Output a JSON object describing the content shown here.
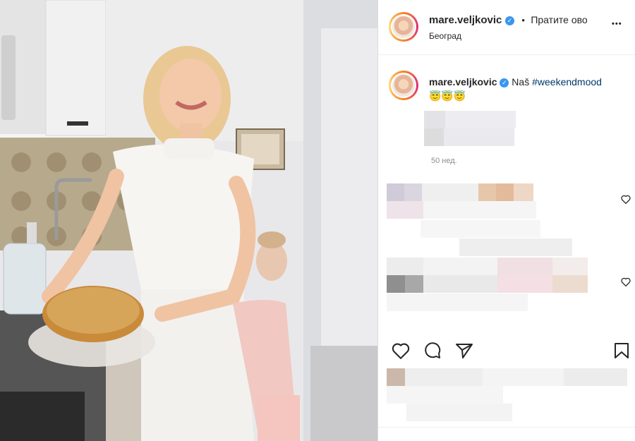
{
  "post": {
    "username": "mare.veljkovic",
    "follow_label": "Пратите ово",
    "dot_separator": "•",
    "location": "Београд",
    "more_label": "•••"
  },
  "caption": {
    "username": "mare.veljkovic",
    "text": "Naš",
    "hashtag": "#weekendmood",
    "emojis": "😇😇😇",
    "time_ago": "50 нед."
  },
  "icons": {
    "verified": "verified-badge-icon",
    "like": "heart-icon",
    "comment": "comment-bubble-icon",
    "share": "paper-plane-icon",
    "save": "bookmark-icon",
    "comment_like": "small-heart-icon"
  },
  "colors": {
    "verified_blue": "#3897f0",
    "hashtag_blue": "#00376b"
  }
}
